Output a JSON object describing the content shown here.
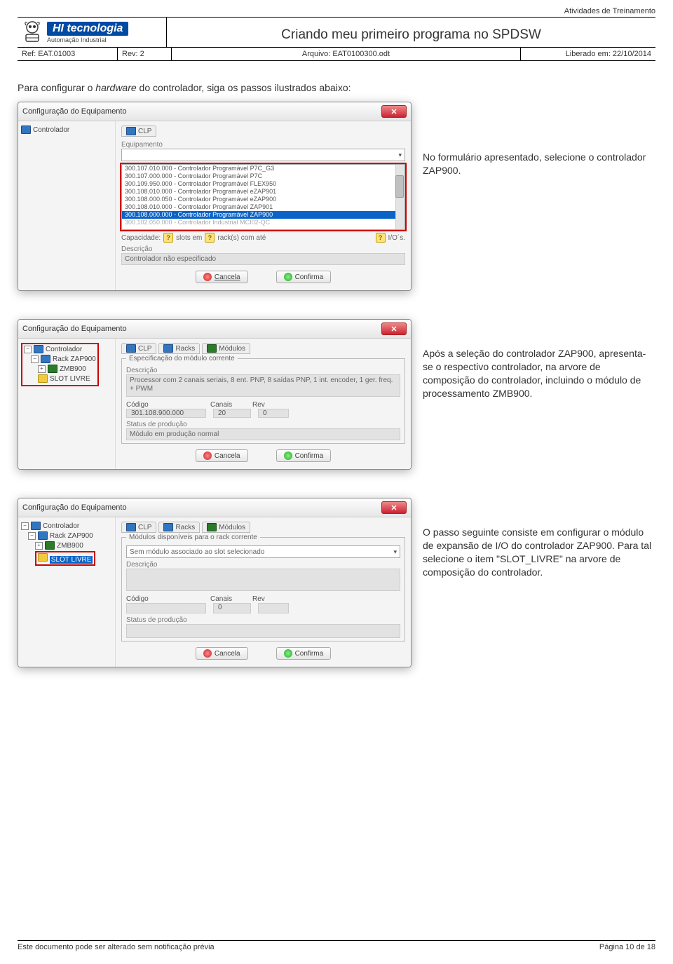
{
  "activity_label": "Atividades de Treinamento",
  "brand": {
    "name": "HI tecnologia",
    "subtitle": "Automação Industrial"
  },
  "doc_title": "Criando meu primeiro programa no SPDSW",
  "meta": {
    "ref": "Ref: EAT.01003",
    "rev": "Rev: 2",
    "file": "Arquivo: EAT0100300.odt",
    "released": "Liberado em: 22/10/2014"
  },
  "intro_before": "Para configurar o ",
  "intro_italic": "hardware",
  "intro_after": " do controlador, siga os passos ilustrados abaixo:",
  "dlg1": {
    "title": "Configuração do Equipamento",
    "tree_root": "Controlador",
    "tabs": [
      "CLP"
    ],
    "label_equip": "Equipamento",
    "items": [
      "300.107.010.000 - Controlador Programável P7C_G3",
      "300.107.000.000 - Controlador Programável P7C",
      "300.109.950.000 - Controlador Programável FLEX950",
      "300.108.010.000 - Controlador Programável eZAP901",
      "300.108.000.050 - Controlador Programável eZAP900",
      "300.108.010.000 - Controlador Programável ZAP901",
      "300.108.000.000 - Controlador Programável ZAP900",
      "300.102.050.000 - Controlador Industrial MCI02-QC"
    ],
    "selected_index": 6,
    "cap": {
      "label": "Capacidade:",
      "slots": "slots em",
      "rack": "rack(s) com até",
      "ios": "I/O´s."
    },
    "desc_label": "Descrição",
    "desc_val": "Controlador não especificado",
    "btn_cancel": "Cancela",
    "btn_confirm": "Confirma"
  },
  "side1": "No formulário apresentado, selecione o controlador ZAP900.",
  "dlg2": {
    "title": "Configuração do Equipamento",
    "tree": {
      "root": "Controlador",
      "rack": "Rack ZAP900",
      "zmb": "ZMB900",
      "slot": "SLOT LIVRE"
    },
    "tabs": [
      "CLP",
      "Racks",
      "Módulos"
    ],
    "fs_label": "Especificação do módulo corrente",
    "desc_label": "Descrição",
    "desc_val": "Processor com 2 canais seriais, 8 ent. PNP, 8 saídas PNP, 1 int. encoder, 1 ger. freq. + PWM",
    "code_label": "Código",
    "ch_label": "Canais",
    "rev_label": "Rev",
    "code_val": "301.108.900.000",
    "ch_val": "20",
    "rev_val": "0",
    "prod_label": "Status de produção",
    "prod_val": "Módulo em produção normal",
    "btn_cancel": "Cancela",
    "btn_confirm": "Confirma"
  },
  "side2": "Após a seleção do controlador ZAP900, apresenta-se o respectivo controlador, na arvore de composição do controlador, incluindo o módulo de processamento ZMB900.",
  "dlg3": {
    "title": "Configuração do Equipamento",
    "tree": {
      "root": "Controlador",
      "rack": "Rack ZAP900",
      "zmb": "ZMB900",
      "slot": "SLOT LIVRE"
    },
    "tabs": [
      "CLP",
      "Racks",
      "Módulos"
    ],
    "fs_label": "Módulos disponíveis para o rack corrente",
    "combo_val": "Sem módulo associado ao slot selecionado",
    "desc_label": "Descrição",
    "code_label": "Código",
    "ch_label": "Canais",
    "rev_label": "Rev",
    "ch_val": "0",
    "prod_label": "Status de produção",
    "btn_cancel": "Cancela",
    "btn_confirm": "Confirma"
  },
  "side3": "O passo seguinte consiste em configurar o módulo de expansão de I/O do controlador ZAP900. Para tal selecione o item \"SLOT_LIVRE\" na arvore de composição do controlador.",
  "footer": {
    "left": "Este documento pode ser alterado sem notificação prévia",
    "right": "Página 10 de 18"
  }
}
